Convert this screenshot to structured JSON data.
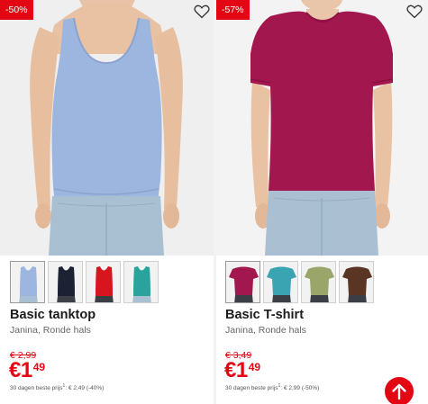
{
  "products": [
    {
      "badge": "-50%",
      "name": "Basic tanktop",
      "subtitle": "Janina, Ronde hals",
      "old_price": "€ 2,99",
      "price_main": "€1",
      "price_cents": "49",
      "price_note": "30 dagen beste prijs",
      "price_note_sup": "1",
      "price_note_tail": ": € 2,49 (-40%)",
      "favorite_icon": "heart-outline-icon",
      "image": {
        "garment": "tank top",
        "color": "#9db6e0"
      },
      "swatches": [
        {
          "color": "#9db6e0",
          "label": "light blue"
        },
        {
          "color": "#1c2233",
          "label": "navy"
        },
        {
          "color": "#d8141f",
          "label": "red"
        },
        {
          "color": "#2aa39c",
          "label": "teal"
        }
      ]
    },
    {
      "badge": "-57%",
      "name": "Basic T-shirt",
      "subtitle": "Janina, Ronde hals",
      "old_price": "€ 3,49",
      "price_main": "€1",
      "price_cents": "49",
      "price_note": "30 dagen beste prijs",
      "price_note_sup": "1",
      "price_note_tail": ": € 2,99 (-50%)",
      "favorite_icon": "heart-outline-icon",
      "image": {
        "garment": "t-shirt",
        "color": "#a3174f"
      },
      "swatches": [
        {
          "color": "#a3174f",
          "label": "berry"
        },
        {
          "color": "#3aa4b3",
          "label": "turquoise"
        },
        {
          "color": "#9aa56a",
          "label": "olive"
        },
        {
          "color": "#5a3524",
          "label": "brown"
        }
      ]
    }
  ],
  "back_to_top_icon": "arrow-up-icon",
  "colors": {
    "accent": "#e30613",
    "divider": "#f3f3f3"
  }
}
